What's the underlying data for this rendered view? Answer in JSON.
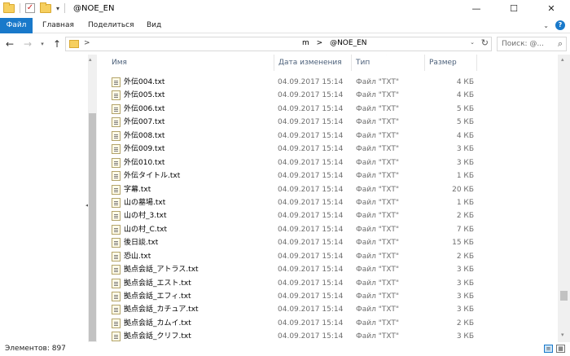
{
  "window": {
    "title": "@NOE_EN",
    "minimize": "—",
    "maximize": "☐",
    "close": "✕"
  },
  "ribbon": {
    "tabs": [
      "Файл",
      "Главная",
      "Поделиться",
      "Вид"
    ]
  },
  "address": {
    "crumb_sep": ">",
    "path": [
      "m",
      ">",
      "@NOE_EN"
    ]
  },
  "search": {
    "placeholder": "Поиск: @..."
  },
  "columns": {
    "name": "Имя",
    "date": "Дата изменения",
    "type": "Тип",
    "size": "Размер"
  },
  "files": [
    {
      "name": "外伝004.txt",
      "date": "04.09.2017 15:14",
      "type": "Файл \"TXT\"",
      "size": "4 КБ"
    },
    {
      "name": "外伝005.txt",
      "date": "04.09.2017 15:14",
      "type": "Файл \"TXT\"",
      "size": "4 КБ"
    },
    {
      "name": "外伝006.txt",
      "date": "04.09.2017 15:14",
      "type": "Файл \"TXT\"",
      "size": "5 КБ"
    },
    {
      "name": "外伝007.txt",
      "date": "04.09.2017 15:14",
      "type": "Файл \"TXT\"",
      "size": "5 КБ"
    },
    {
      "name": "外伝008.txt",
      "date": "04.09.2017 15:14",
      "type": "Файл \"TXT\"",
      "size": "4 КБ"
    },
    {
      "name": "外伝009.txt",
      "date": "04.09.2017 15:14",
      "type": "Файл \"TXT\"",
      "size": "3 КБ"
    },
    {
      "name": "外伝010.txt",
      "date": "04.09.2017 15:14",
      "type": "Файл \"TXT\"",
      "size": "3 КБ"
    },
    {
      "name": "外伝タイトル.txt",
      "date": "04.09.2017 15:14",
      "type": "Файл \"TXT\"",
      "size": "1 КБ"
    },
    {
      "name": "字幕.txt",
      "date": "04.09.2017 15:14",
      "type": "Файл \"TXT\"",
      "size": "20 КБ"
    },
    {
      "name": "山の墓場.txt",
      "date": "04.09.2017 15:14",
      "type": "Файл \"TXT\"",
      "size": "1 КБ"
    },
    {
      "name": "山の村_3.txt",
      "date": "04.09.2017 15:14",
      "type": "Файл \"TXT\"",
      "size": "2 КБ"
    },
    {
      "name": "山の村_C.txt",
      "date": "04.09.2017 15:14",
      "type": "Файл \"TXT\"",
      "size": "7 КБ"
    },
    {
      "name": "後日談.txt",
      "date": "04.09.2017 15:14",
      "type": "Файл \"TXT\"",
      "size": "15 КБ"
    },
    {
      "name": "恐山.txt",
      "date": "04.09.2017 15:14",
      "type": "Файл \"TXT\"",
      "size": "2 КБ"
    },
    {
      "name": "拠点会話_アトラス.txt",
      "date": "04.09.2017 15:14",
      "type": "Файл \"TXT\"",
      "size": "3 КБ"
    },
    {
      "name": "拠点会話_エスト.txt",
      "date": "04.09.2017 15:14",
      "type": "Файл \"TXT\"",
      "size": "3 КБ"
    },
    {
      "name": "拠点会話_エフィ.txt",
      "date": "04.09.2017 15:14",
      "type": "Файл \"TXT\"",
      "size": "3 КБ"
    },
    {
      "name": "拠点会話_カチュア.txt",
      "date": "04.09.2017 15:14",
      "type": "Файл \"TXT\"",
      "size": "3 КБ"
    },
    {
      "name": "拠点会話_カムイ.txt",
      "date": "04.09.2017 15:14",
      "type": "Файл \"TXT\"",
      "size": "2 КБ"
    },
    {
      "name": "拠点会話_クリフ.txt",
      "date": "04.09.2017 15:14",
      "type": "Файл \"TXT\"",
      "size": "3 КБ"
    }
  ],
  "status": {
    "items_count": "Элементов: 897"
  },
  "colors": {
    "file_tab": "#1979ca",
    "header_text": "#4c607a",
    "meta_text": "#6d6d6d"
  }
}
